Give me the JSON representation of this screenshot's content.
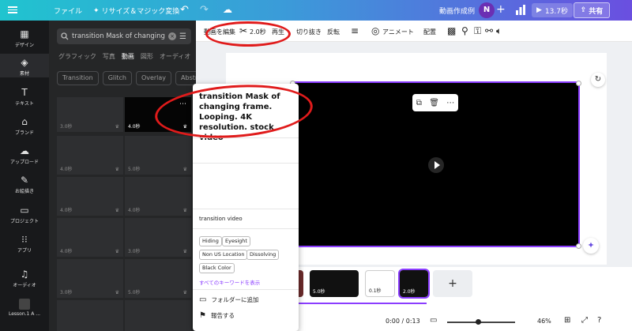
{
  "topbar": {
    "file_label": "ファイル",
    "resize_label": "リサイズ＆マジック変換",
    "title": "動画作成例",
    "avatar_letter": "N",
    "play_duration": "13.7秒",
    "share_label": "共有"
  },
  "rail": {
    "items": [
      {
        "label": "デザイン",
        "icon": "layout-icon"
      },
      {
        "label": "素材",
        "icon": "elements-icon"
      },
      {
        "label": "テキスト",
        "icon": "text-icon"
      },
      {
        "label": "ブランド",
        "icon": "brand-icon"
      },
      {
        "label": "アップロード",
        "icon": "upload-icon"
      },
      {
        "label": "お絵描き",
        "icon": "draw-icon"
      },
      {
        "label": "プロジェクト",
        "icon": "folder-icon"
      },
      {
        "label": "アプリ",
        "icon": "apps-icon"
      },
      {
        "label": "オーディオ",
        "icon": "audio-icon"
      },
      {
        "label": "Lesson.1 A ..."
      }
    ]
  },
  "panel": {
    "search_value": "transition Mask of changing fra",
    "tabs": [
      "グラフィック",
      "写真",
      "動画",
      "図形",
      "オーディオ"
    ],
    "chips": [
      "Transition",
      "Glitch",
      "Overlay",
      "Abstra"
    ],
    "thumbs": [
      {
        "dur": "3.0秒"
      },
      {
        "dur": "4.0秒"
      },
      {
        "dur": "4.0秒"
      },
      {
        "dur": "5.0秒"
      },
      {
        "dur": "4.0秒"
      },
      {
        "dur": "4.0秒"
      },
      {
        "dur": "4.0秒"
      },
      {
        "dur": "3.0秒"
      },
      {
        "dur": "3.0秒"
      },
      {
        "dur": "5.0秒"
      }
    ]
  },
  "toolbar2": {
    "edit_video": "動画を編集",
    "duration": "2.0秒",
    "play": "再生",
    "crop": "切り抜き",
    "flip": "反転",
    "animate": "アニメート",
    "position": "配置"
  },
  "popover": {
    "title": "transition Mask of changing frame. Looping. 4K resolution. stock video",
    "subtitle": "transition video",
    "keywords": [
      "Hiding",
      "Eyesight",
      "Non US Location",
      "Dissolving",
      "Black Color"
    ],
    "show_all": "すべてのキーワードを表示",
    "add_folder": "フォルダーに追加",
    "report": "報告する"
  },
  "timeline": {
    "clips": [
      {
        "label": "5.0秒"
      },
      {
        "label": "0.1秒"
      },
      {
        "label": "2.0秒"
      }
    ]
  },
  "bottombar": {
    "time": "0:00 / 0:13",
    "zoom": "46%"
  },
  "colors": {
    "accent": "#8b3dff",
    "annotation": "#e01b1b"
  }
}
